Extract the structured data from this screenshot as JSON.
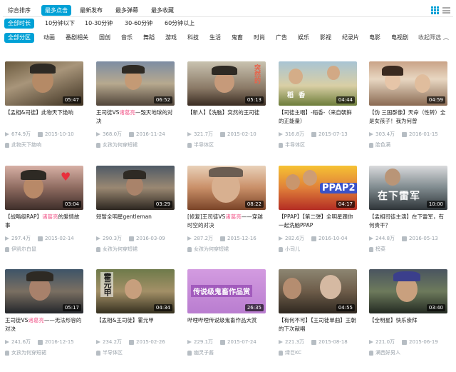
{
  "sort": {
    "items": [
      "综合排序",
      "最多点击",
      "最新发布",
      "最多弹幕",
      "最多收藏"
    ],
    "active": 1
  },
  "durations": {
    "items": [
      "全部时长",
      "10分钟以下",
      "10-30分钟",
      "30-60分钟",
      "60分钟以上"
    ],
    "active": 0
  },
  "zones": {
    "items": [
      "全部分区",
      "动画",
      "番剧相关",
      "国创",
      "音乐",
      "舞蹈",
      "游戏",
      "科技",
      "生活",
      "鬼畜",
      "时尚",
      "广告",
      "娱乐",
      "影视",
      "纪录片",
      "电影",
      "电视剧"
    ],
    "active": 0,
    "collapse_label": "收起筛选"
  },
  "icons": {
    "grid_view": "grid-view-icon",
    "list_view": "list-view-icon",
    "play": "play-icon",
    "date": "calendar-icon",
    "uploader": "user-icon",
    "collapse": "chevron-up-icon"
  },
  "colors": {
    "accent": "#00a1d6",
    "highlight": "#f25d8e",
    "meta": "#99a2aa"
  },
  "videos": [
    {
      "duration": "05:47",
      "title_parts": [
        "【孟相&司徒】此物天下绝响",
        ""
      ],
      "views": "674.9万",
      "date": "2015-10-10",
      "uploader": "此物天下绝响",
      "overlay": ""
    },
    {
      "duration": "06:52",
      "title_parts": [
        "王司徒VS",
        "诸葛亮",
        "—毁灭地球的对决"
      ],
      "views": "368.0万",
      "date": "2016-11-24",
      "uploader": "女孩为何穿短裙",
      "overlay": ""
    },
    {
      "duration": "05:13",
      "title_parts": [
        "【新人】【洗脑】突然的王司徒",
        ""
      ],
      "views": "321.7万",
      "date": "2015-02-10",
      "uploader": "半导体区",
      "overlay": "突然的"
    },
    {
      "duration": "04:44",
      "title_parts": [
        "【司徒主唱】-稻香-（来自朝鲜的正能量）",
        ""
      ],
      "views": "316.8万",
      "date": "2015-07-13",
      "uploader": "半导体区",
      "overlay": "稻 香"
    },
    {
      "duration": "04:59",
      "title_parts": [
        "【伪 三国群像】天命（性转）全是女孩子！我为何曾",
        ""
      ],
      "views": "303.4万",
      "date": "2016-01-15",
      "uploader": "脸色满",
      "overlay": ""
    },
    {
      "duration": "03:04",
      "title_parts": [
        "【战略级RAP】",
        "诸葛亮",
        "的爱情故事"
      ],
      "views": "297.4万",
      "date": "2015-02-14",
      "uploader": "伊凯尔白鼠",
      "overlay": ""
    },
    {
      "duration": "03:29",
      "title_parts": [
        "短暂全明星gentleman",
        ""
      ],
      "views": "290.3万",
      "date": "2016-03-09",
      "uploader": "女孩为何穿短裙",
      "overlay": ""
    },
    {
      "duration": "08:22",
      "title_parts": [
        "[修复]王司徒VS",
        "诸葛亮",
        "——穿越时空的对决"
      ],
      "views": "287.2万",
      "date": "2015-12-16",
      "uploader": "女孩为何穿短裙",
      "overlay": ""
    },
    {
      "duration": "04:17",
      "title_parts": [
        "【PPAP】【第二弹】全明星跟你一起洗脑PPAP",
        ""
      ],
      "views": "282.6万",
      "date": "2016-10-04",
      "uploader": "小司儿",
      "overlay": "PPAP2"
    },
    {
      "duration": "10:00",
      "title_parts": [
        "【孟相司徒主演】在下雷军，有何贵干？",
        ""
      ],
      "views": "244.8万",
      "date": "2016-05-13",
      "uploader": "榜菜",
      "overlay": "在下雷军"
    },
    {
      "duration": "05:17",
      "title_parts": [
        "王司徒VS",
        "诸葛亮",
        "——无法形容的对决"
      ],
      "views": "241.6万",
      "date": "2016-12-15",
      "uploader": "女孩为何穿短裙",
      "overlay": ""
    },
    {
      "duration": "04:34",
      "title_parts": [
        "【孟相&王司徒】霍元甲",
        ""
      ],
      "views": "234.2万",
      "date": "2015-02-26",
      "uploader": "半导体区",
      "overlay": "霍元甲"
    },
    {
      "duration": "26:35",
      "title_parts": [
        "哔哩哔哩传说级鬼畜作品大赏",
        ""
      ],
      "views": "229.1万",
      "date": "2015-07-24",
      "uploader": "幽灵子酱",
      "overlay": "传说级鬼畜作品赏"
    },
    {
      "duration": "04:55",
      "title_parts": [
        "【有何不可】【王司徒单曲】王朝的下次献唱",
        ""
      ],
      "views": "221.3万",
      "date": "2015-08-18",
      "uploader": "绿巨KC",
      "overlay": ""
    },
    {
      "duration": "03:40",
      "title_parts": [
        "【全明星】快乐崇拜",
        ""
      ],
      "views": "221.0万",
      "date": "2015-06-19",
      "uploader": "满西好男人",
      "overlay": ""
    }
  ]
}
